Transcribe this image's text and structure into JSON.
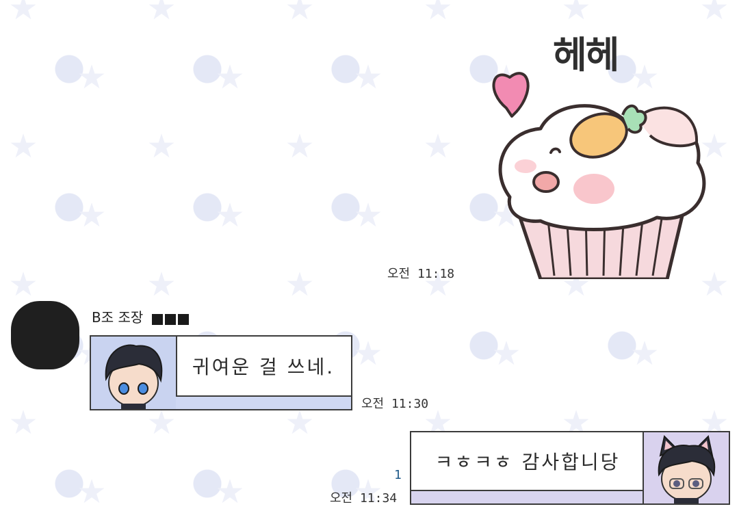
{
  "sticker": {
    "caption": "헤헤",
    "time": "오전 11:18",
    "icon": "cupcake-sticker"
  },
  "incoming": {
    "sender_name": "B조 조장",
    "avatar_icon": "avatar-redacted",
    "message": "귀여운 걸 쓰네.",
    "time": "오전 11:30"
  },
  "outgoing": {
    "unread_count": "1",
    "message": "ㅋㅎㅋㅎ 감사합니당",
    "time": "오전 11:34"
  },
  "colors": {
    "incoming_band": "#cfd8f3",
    "outgoing_band": "#d8d4ef",
    "unread": "#1f5a8a"
  }
}
